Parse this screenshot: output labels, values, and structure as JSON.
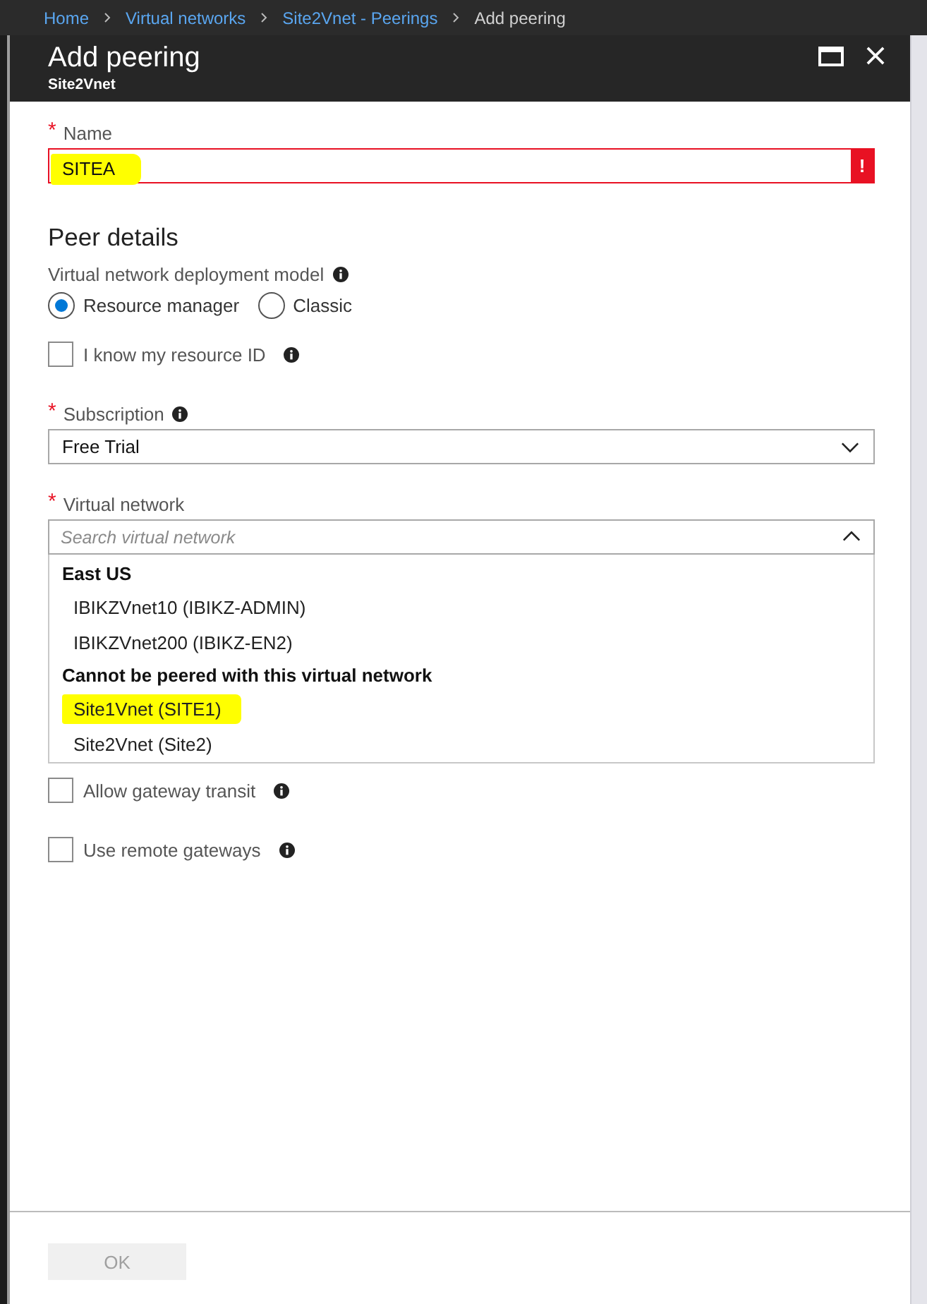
{
  "breadcrumb": [
    {
      "label": "Home",
      "link": true
    },
    {
      "label": "Virtual networks",
      "link": true
    },
    {
      "label": "Site2Vnet - Peerings",
      "link": true
    },
    {
      "label": "Add peering",
      "link": false
    }
  ],
  "blade": {
    "title": "Add peering",
    "subtitle": "Site2Vnet"
  },
  "name_field": {
    "required_mark": "*",
    "label": "Name",
    "value": "SITEA",
    "error": true,
    "error_mark": "!",
    "highlighted": true
  },
  "section_title": "Peer details",
  "deployment_model": {
    "label": "Virtual network deployment model",
    "info": true,
    "options": [
      {
        "label": "Resource manager",
        "selected": true
      },
      {
        "label": "Classic",
        "selected": false
      }
    ]
  },
  "resource_id": {
    "label": "I know my resource ID",
    "checked": false,
    "info": true
  },
  "subscription": {
    "required_mark": "*",
    "label": "Subscription",
    "info": true,
    "value": "Free Trial"
  },
  "virtual_network": {
    "required_mark": "*",
    "label": "Virtual network",
    "placeholder": "Search virtual network",
    "expanded": true,
    "groups": [
      {
        "heading": "East US",
        "items": [
          {
            "label": "IBIKZVnet10 (IBIKZ-ADMIN)",
            "highlighted": false
          },
          {
            "label": "IBIKZVnet200 (IBIKZ-EN2)",
            "highlighted": false
          }
        ]
      },
      {
        "heading": "Cannot be peered with this virtual network",
        "items": [
          {
            "label": "Site1Vnet (SITE1)",
            "highlighted": true
          },
          {
            "label": "Site2Vnet (Site2)",
            "highlighted": false
          }
        ]
      }
    ]
  },
  "gateway_options": [
    {
      "label": "Allow gateway transit",
      "checked": false,
      "info": true
    },
    {
      "label": "Use remote gateways",
      "checked": false,
      "info": true
    }
  ],
  "ok_button": {
    "label": "OK",
    "disabled": true
  }
}
